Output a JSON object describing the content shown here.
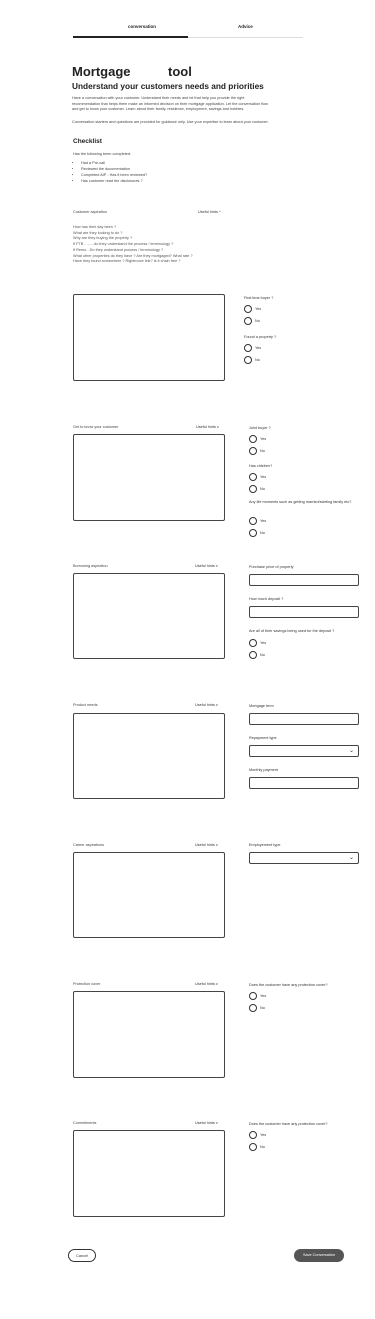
{
  "tabs": {
    "conversation": "conversation",
    "advice": "Advice"
  },
  "title": {
    "part1": "Mortgage",
    "part2": "tool"
  },
  "subtitle": "Understand your customers needs and priorities",
  "intro_lines": [
    "Have a conversation with your customer. Understand their needs and let that help you provide the right",
    "recommendation that helps them make an informed decision on their mortgage application.  Let the conversation flow",
    "and get to know your customer. Learn about their family, residence, employment, savings and hobbies."
  ],
  "intro_note": "Conversation starters and questions are provided for guidance only. Use your expertise to learn about your customer.",
  "checklist": {
    "title": "Checklist",
    "question": "Has the following been completed:",
    "items": [
      "Had a Pre-call",
      "Reviewed the documentation",
      "Completed AIP - Has it been reviewed?",
      "Has customer read the disclosures ?"
    ]
  },
  "sections": {
    "aspiration": {
      "title": "Customer aspiration",
      "hint": "Useful hints",
      "hint_icon": "^",
      "questions": [
        "How has their day been ?",
        "What are they looking to do ?",
        "Why are they buying the property ?",
        "If FTB - .......do they understand the process / terminology ?",
        "If Remo - Do they understand process / terminology ?",
        "What other properties do they have ? Are they mortgaged? What rate ?",
        "Have they found somewhere ? Rightmove link? Is it chain free ?"
      ],
      "side": {
        "first_time_buyer": "First time buyer ?",
        "found_property": "Found a property ?"
      }
    },
    "know_customer": {
      "title": "Get to know your customer",
      "hint": "Useful hints",
      "side": {
        "joint_buyer": "Joint buyer ?",
        "has_children": "Has children?",
        "life_moments": "Any life moments such as getting married/starting family etc?"
      }
    },
    "borrowing": {
      "title": "Borrowing  aspiration",
      "hint": "Useful hints",
      "side": {
        "purchase_price": "Purchase price of property",
        "deposit": "How much deposit ?",
        "savings_used": "Are all of their savings being used for the deposit ?"
      }
    },
    "product": {
      "title": "Product needs",
      "hint": "Useful hints",
      "side": {
        "mortgage_term": "Mortgage term",
        "repayment_type": "Repayment type",
        "monthly_payment": "Monthly payment"
      }
    },
    "career": {
      "title": "Career aspirations",
      "hint": "Useful hints",
      "side": {
        "employment_type": "Employement type"
      }
    },
    "protection": {
      "title": "Protection cover",
      "hint": "Useful hints",
      "side": {
        "protection_q": "Does the customer have any protection cover?"
      }
    },
    "commitments": {
      "title": "Commitments",
      "hint": "Useful hints",
      "side": {
        "protection_q": "Does the customer have any protection cover?"
      }
    }
  },
  "options": {
    "yes": "Yes",
    "no": "No"
  },
  "hint_chevron": "v",
  "select_chevron": "⌄",
  "footer": {
    "cancel": "Cancel",
    "save": "Save Conversation"
  }
}
